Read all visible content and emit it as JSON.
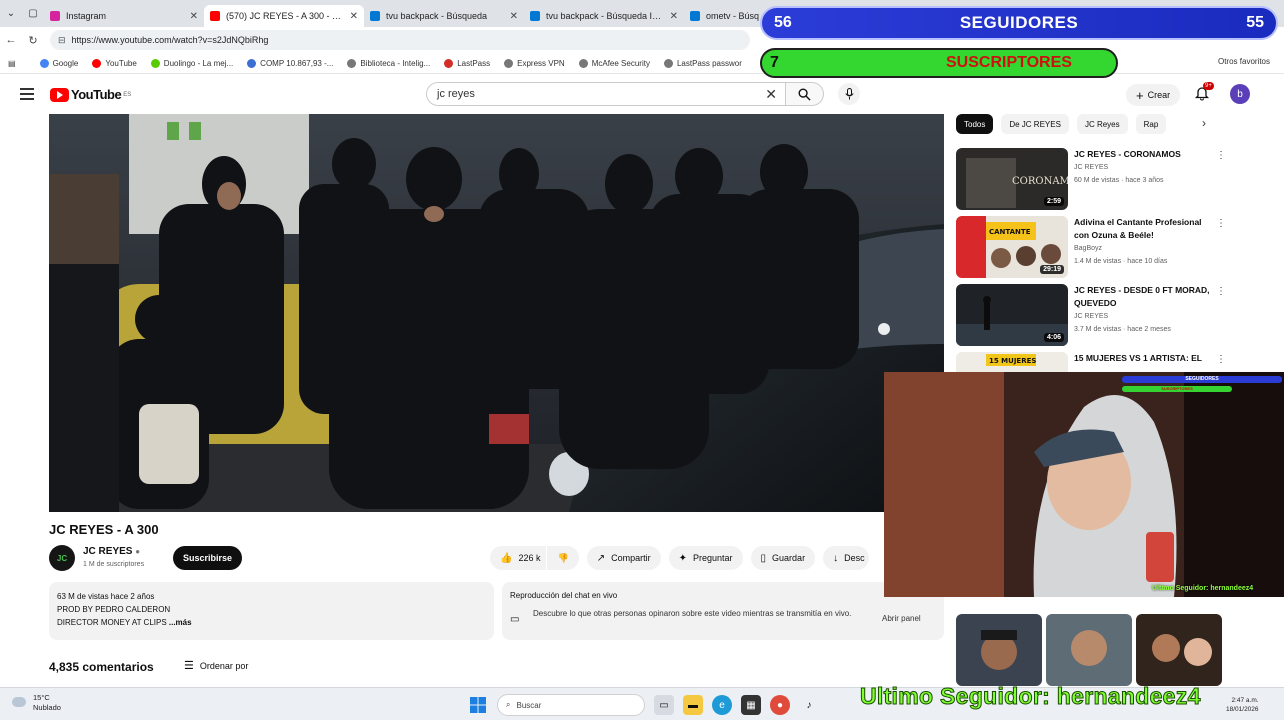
{
  "browser": {
    "tabs": [
      {
        "title": "Instagram",
        "color": "#d6249f"
      },
      {
        "title": "(570) JC REYES - A 300 - YouT",
        "color": "#ff0000",
        "active": true
      },
      {
        "title": "tvu backpack - Búsqueda",
        "color": "#0078d4"
      },
      {
        "title": "tvu backpack - Búsqueda Imágene",
        "color": "#0078d4"
      },
      {
        "title": "ometv - Búsq",
        "color": "#0078d4"
      }
    ],
    "url": "https://www.youtube.com/watch?v=s2JdNQbiRhg",
    "bookmarks": [
      {
        "label": "Google",
        "color": "#4285f4"
      },
      {
        "label": "YouTube",
        "color": "#ff0000"
      },
      {
        "label": "Duolingo - La mej...",
        "color": "#58cc02"
      },
      {
        "label": "COMP 10.867,93 -...",
        "color": "#3b6fd6"
      },
      {
        "label": "Biblioteca - Intelig...",
        "color": "#777777"
      },
      {
        "label": "LastPass",
        "color": "#d32d27"
      },
      {
        "label": "Express VPN",
        "color": "#777777"
      },
      {
        "label": "McAfee Security",
        "color": "#777777"
      },
      {
        "label": "LastPass passwor",
        "color": "#777777"
      }
    ],
    "other_favorites": "Otros favoritos"
  },
  "youtube": {
    "logo_text": "YouTube",
    "logo_region": "ES",
    "search_value": "jc reyes",
    "create_label": "Crear",
    "notif_count": "9+",
    "avatar_letter": "b"
  },
  "video": {
    "title": "JC REYES - A 300",
    "channel": "JC REYES",
    "channel_avatar": "JC",
    "subscribers": "1 M de suscriptores",
    "subscribe_label": "Suscribirse",
    "likes": "226 k",
    "share": "Compartir",
    "ask": "Preguntar",
    "save": "Guardar",
    "download": "Desc"
  },
  "description": {
    "meta": "63 M de vistas  hace 2 años",
    "line1": "PROD BY PEDRO CALDERON",
    "line2": "DIRECTOR MONEY AT CLIPS",
    "more": "...más"
  },
  "live_chat": {
    "title": "Reproducción del chat en vivo",
    "text": "Descubre lo que otras personas opinaron sobre este video mientras se transmitía en vivo.",
    "button": "Abrir panel"
  },
  "comments": {
    "count": "4,835 comentarios",
    "sort": "Ordenar por"
  },
  "chips": [
    "Todos",
    "De JC REYES",
    "JC Reyes",
    "Rap"
  ],
  "recommendations": [
    {
      "title": "JC REYES - CORONAMOS",
      "channel": "JC REYES",
      "views": "60 M de vistas · hace 3 años",
      "duration": "2:59"
    },
    {
      "title": "Adivina el Cantante Profesional con Ozuna & Beéle!",
      "channel": "BagBoyz",
      "views": "1.4 M de vistas · hace 10 días",
      "duration": "29:19"
    },
    {
      "title": "JC REYES - DESDE 0 FT MORAD, QUEVEDO",
      "channel": "JC REYES",
      "views": "3.7 M de vistas · hace 2 meses",
      "duration": "4:06"
    },
    {
      "title": "15 MUJERES VS 1 ARTISTA: EL",
      "channel": "",
      "views": "",
      "duration": ""
    }
  ],
  "overlay": {
    "followers_count_left": "56",
    "followers_label": "SEGUIDORES",
    "followers_count_right": "55",
    "subs_count": "7",
    "subs_label": "SUSCRIPTORES",
    "mini_followers": "SEGUIDORES",
    "mini_subs": "SUSCRIPTORES",
    "cam_last_follower": "Ultimo Seguidor: hernandeez4",
    "last_follower": "Ultimo Seguidor: hernandeez4"
  },
  "taskbar": {
    "temp": "15°C",
    "weather": "Nublado",
    "search": "Buscar",
    "time": "2:47 a.m.",
    "date": "18/01/2026"
  }
}
